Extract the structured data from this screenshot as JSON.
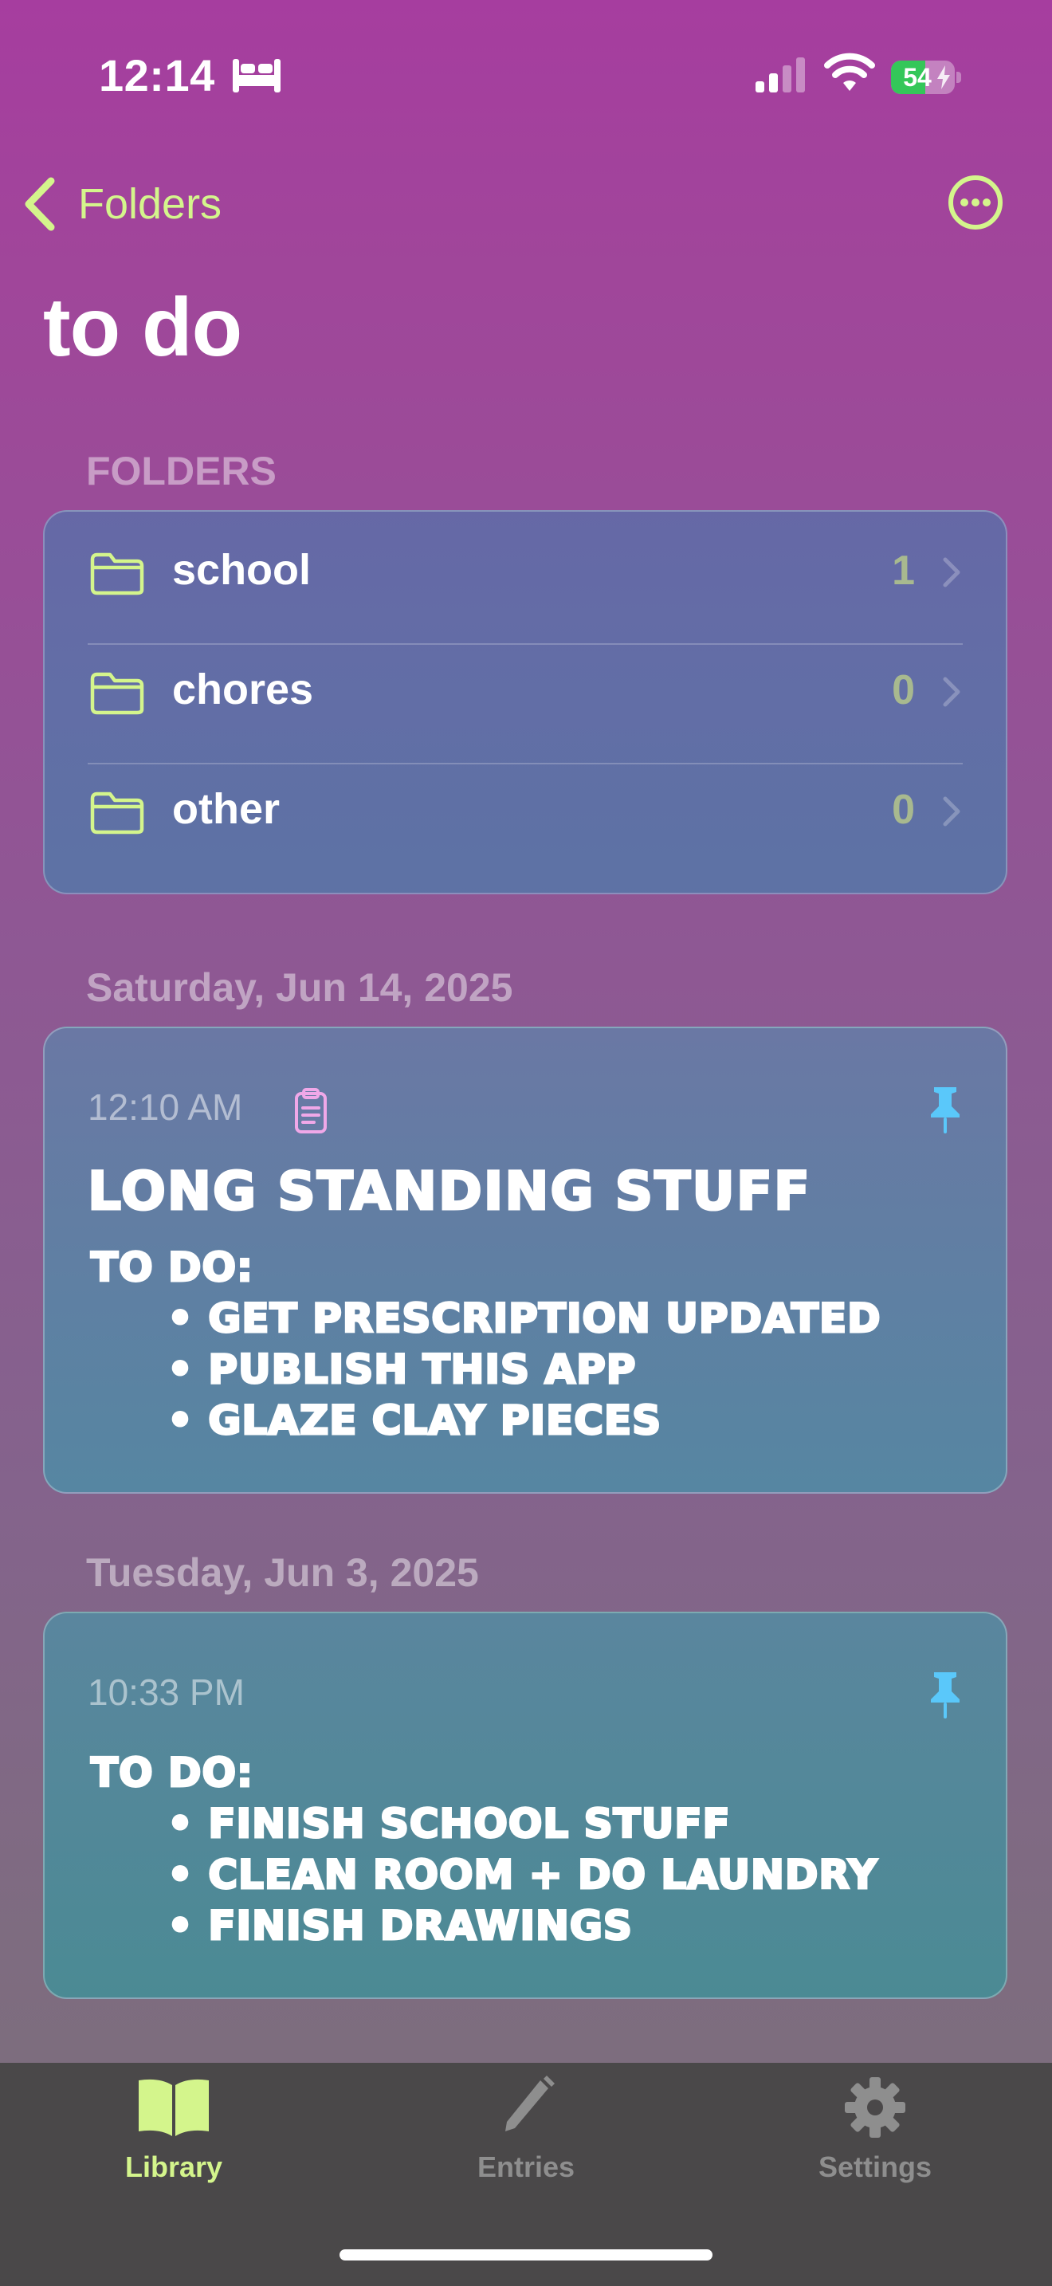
{
  "status_bar": {
    "time": "12:14",
    "battery_level": "54",
    "icons": [
      "bed-icon",
      "cellular-signal-icon",
      "wifi-icon",
      "battery-charging-icon"
    ]
  },
  "nav": {
    "back_label": "Folders",
    "back_icon": "chevron-left-icon",
    "more_icon": "ellipsis-circle-icon"
  },
  "page_title": "to do",
  "colors": {
    "accent": "#d4f58c",
    "pin": "#5ac8fa",
    "clipboard": "#f0a8e8",
    "tab_bar": "#4a4849",
    "inactive_tab": "#8e8e8e"
  },
  "folders_section": {
    "header": "FOLDERS",
    "items": [
      {
        "label": "school",
        "count": "1"
      },
      {
        "label": "chores",
        "count": "0"
      },
      {
        "label": "other",
        "count": "0"
      }
    ]
  },
  "entries": [
    {
      "date": "Saturday, Jun 14, 2025",
      "time": "12:10 AM",
      "title": "LONG STANDING STUFF",
      "body": {
        "heading": "TO DO:",
        "items": [
          "• GET PRESCRIPTION UPDATED",
          "• PUBLISH THIS APP",
          "• GLAZE CLAY PIECES"
        ]
      }
    },
    {
      "date": "Tuesday, Jun 3, 2025",
      "time": "10:33 PM",
      "body": {
        "heading": "TO DO:",
        "items": [
          "• FINISH SCHOOL STUFF",
          "• CLEAN ROOM + DO LAUNDRY",
          "• FINISH DRAWINGS"
        ]
      }
    }
  ],
  "tab_bar": {
    "tabs": [
      {
        "label": "Library",
        "icon": "book-icon",
        "active": true
      },
      {
        "label": "Entries",
        "icon": "pencil-icon",
        "active": false
      },
      {
        "label": "Settings",
        "icon": "gear-icon",
        "active": false
      }
    ]
  }
}
